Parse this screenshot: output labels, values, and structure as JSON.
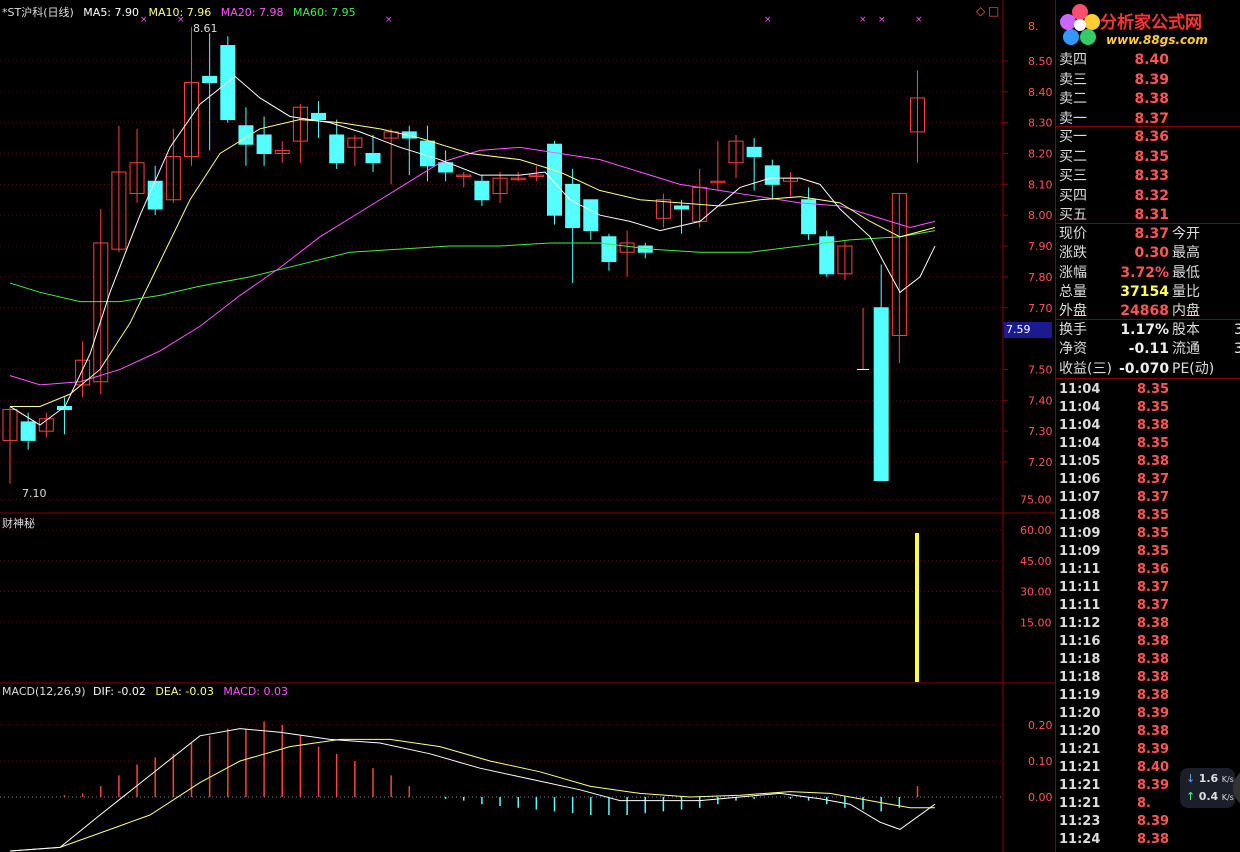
{
  "chart": {
    "title": "*ST沪科(日线)",
    "ma5": "MA5: 7.90",
    "ma10": "MA10: 7.96",
    "ma20": "MA20: 7.98",
    "ma60": "MA60: 7.95",
    "high_mark": "8.61",
    "low_mark": "7.10",
    "price_axis": [
      "8.50",
      "8.40",
      "8.30",
      "8.20",
      "8.10",
      "8.00",
      "7.90",
      "7.80",
      "7.70",
      "7.50",
      "7.40",
      "7.30",
      "7.20"
    ],
    "top_label": "8.",
    "current_tag": "7.59",
    "colors": {
      "up": "#ff4040",
      "down": "#55ffff",
      "ma5": "#ffffff",
      "ma10": "#ffff88",
      "ma20": "#ff55ff",
      "ma60": "#44ee44",
      "grid": "#8b0000"
    }
  },
  "indicator": {
    "name": "财神秘",
    "axis": [
      "75.00",
      "60.00",
      "45.00",
      "30.00",
      "15.00"
    ]
  },
  "macd": {
    "title": "MACD(12,26,9)",
    "dif": "DIF: -0.02",
    "dea": "DEA: -0.03",
    "macd": "MACD: 0.03",
    "axis": [
      "0.20",
      "0.10",
      "0.00"
    ]
  },
  "logo": {
    "name": "分析家公式网",
    "url": "www.88gs.com"
  },
  "quotes": {
    "sell": [
      {
        "label": "卖四",
        "price": "8.40"
      },
      {
        "label": "卖三",
        "price": "8.39"
      },
      {
        "label": "卖二",
        "price": "8.38"
      },
      {
        "label": "卖一",
        "price": "8.37"
      }
    ],
    "buy": [
      {
        "label": "买一",
        "price": "8.36"
      },
      {
        "label": "买二",
        "price": "8.35"
      },
      {
        "label": "买三",
        "price": "8.33"
      },
      {
        "label": "买四",
        "price": "8.32"
      },
      {
        "label": "买五",
        "price": "8.31"
      }
    ],
    "stats": [
      {
        "label": "现价",
        "value": "8.37",
        "label2": "今开",
        "color": "red"
      },
      {
        "label": "涨跌",
        "value": "0.30",
        "label2": "最高",
        "color": "red"
      },
      {
        "label": "涨幅",
        "value": "3.72%",
        "label2": "最低",
        "color": "red"
      },
      {
        "label": "总量",
        "value": "37154",
        "label2": "量比",
        "color": "yel"
      },
      {
        "label": "外盘",
        "value": "24868",
        "label2": "内盘",
        "color": "red"
      },
      {
        "label": "换手",
        "value": "1.17%",
        "label2": "股本",
        "color": "wht"
      },
      {
        "label": "净资",
        "value": "-0.11",
        "label2": "流通",
        "color": "wht"
      },
      {
        "label": "收益(三)",
        "value": "-0.070",
        "label2": "PE(动)",
        "color": "wht"
      }
    ],
    "stats_right_edge": [
      "",
      "",
      "",
      "",
      "",
      "3",
      "3",
      ""
    ]
  },
  "ticks": [
    {
      "time": "11:04",
      "price": "8.35"
    },
    {
      "time": "11:04",
      "price": "8.35"
    },
    {
      "time": "11:04",
      "price": "8.38"
    },
    {
      "time": "11:04",
      "price": "8.35"
    },
    {
      "time": "11:05",
      "price": "8.38"
    },
    {
      "time": "11:06",
      "price": "8.37"
    },
    {
      "time": "11:07",
      "price": "8.37"
    },
    {
      "time": "11:08",
      "price": "8.35"
    },
    {
      "time": "11:09",
      "price": "8.35"
    },
    {
      "time": "11:09",
      "price": "8.35"
    },
    {
      "time": "11:11",
      "price": "8.36"
    },
    {
      "time": "11:11",
      "price": "8.37"
    },
    {
      "time": "11:11",
      "price": "8.37"
    },
    {
      "time": "11:12",
      "price": "8.38"
    },
    {
      "time": "11:16",
      "price": "8.38"
    },
    {
      "time": "11:18",
      "price": "8.38"
    },
    {
      "time": "11:18",
      "price": "8.38"
    },
    {
      "time": "11:19",
      "price": "8.38"
    },
    {
      "time": "11:20",
      "price": "8.39"
    },
    {
      "time": "11:20",
      "price": "8.38"
    },
    {
      "time": "11:21",
      "price": "8.39"
    },
    {
      "time": "11:21",
      "price": "8.40"
    },
    {
      "time": "11:21",
      "price": "8.39"
    },
    {
      "time": "11:21",
      "price": "8."
    },
    {
      "time": "11:23",
      "price": "8.39"
    },
    {
      "time": "11:24",
      "price": "8.38"
    }
  ],
  "network": {
    "down": "1.6",
    "down_unit": "K/s",
    "up": "0.4",
    "up_unit": "K/s"
  }
}
